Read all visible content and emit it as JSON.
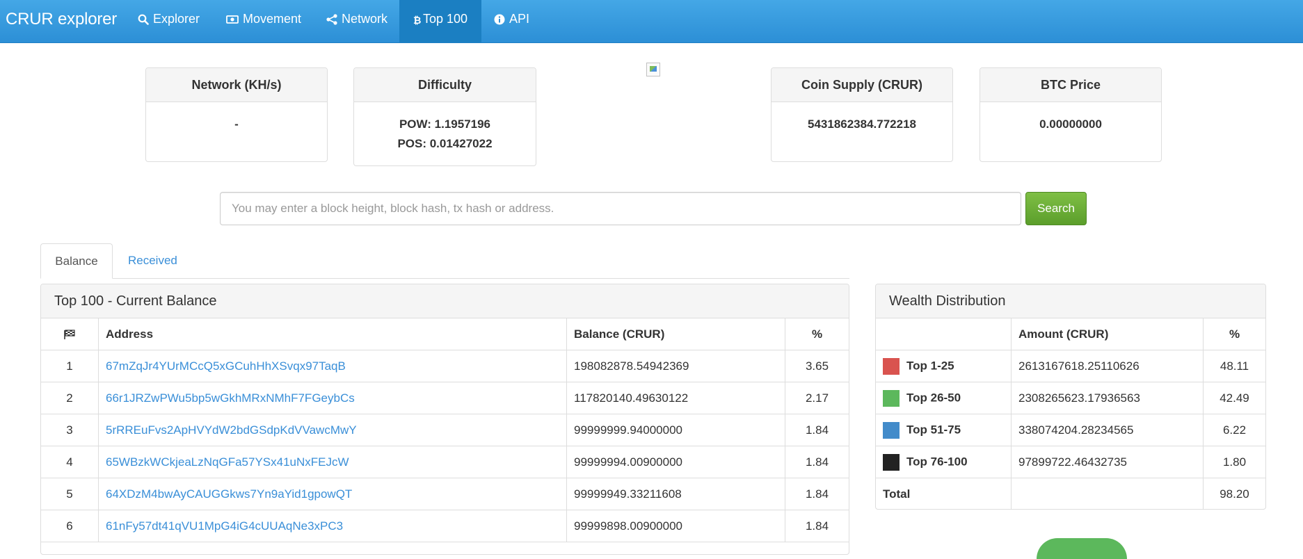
{
  "navbar": {
    "brand": "CRUR explorer",
    "items": [
      {
        "label": "Explorer",
        "icon": "search-icon",
        "active": false
      },
      {
        "label": "Movement",
        "icon": "money-icon",
        "active": false
      },
      {
        "label": "Network",
        "icon": "share-icon",
        "active": false
      },
      {
        "label": "Top 100",
        "icon": "bitcoin-icon",
        "active": true
      },
      {
        "label": "API",
        "icon": "info-circle-icon",
        "active": false
      }
    ],
    "color": "#2c8fd6",
    "active_color": "#1b7fc2"
  },
  "stats": {
    "network": {
      "title": "Network (KH/s)",
      "value": "-"
    },
    "difficulty": {
      "title": "Difficulty",
      "pow": "POW: 1.1957196",
      "pos": "POS: 0.01427022"
    },
    "supply": {
      "title": "Coin Supply (CRUR)",
      "value": "5431862384.772218"
    },
    "btc_price": {
      "title": "BTC Price",
      "value": "0.00000000"
    }
  },
  "search": {
    "placeholder": "You may enter a block height, block hash, tx hash or address.",
    "button_label": "Search",
    "button_color": "#5b9e2b"
  },
  "tabs": [
    {
      "label": "Balance",
      "active": true
    },
    {
      "label": "Received",
      "active": false
    }
  ],
  "top100": {
    "title": "Top 100 - Current Balance",
    "headers": {
      "rank_icon": "flag-checkered-icon",
      "address": "Address",
      "balance": "Balance (CRUR)",
      "percent": "%"
    },
    "rows": [
      {
        "rank": "1",
        "address": "67mZqJr4YUrMCcQ5xGCuhHhXSvqx97TaqB",
        "balance": "198082878.54942369",
        "percent": "3.65"
      },
      {
        "rank": "2",
        "address": "66r1JRZwPWu5bp5wGkhMRxNMhF7FGeybCs",
        "balance": "117820140.49630122",
        "percent": "2.17"
      },
      {
        "rank": "3",
        "address": "5rRREuFvs2ApHVYdW2bdGSdpKdVVawcMwY",
        "balance": "99999999.94000000",
        "percent": "1.84"
      },
      {
        "rank": "4",
        "address": "65WBzkWCkjeaLzNqGFa57YSx41uNxFEJcW",
        "balance": "99999994.00900000",
        "percent": "1.84"
      },
      {
        "rank": "5",
        "address": "64XDzM4bwAyCAUGGkws7Yn9aYid1gpowQT",
        "balance": "99999949.33211608",
        "percent": "1.84"
      },
      {
        "rank": "6",
        "address": "61nFy57dt41qVU1MpG4iG4cUUAqNe3xPC3",
        "balance": "99999898.00900000",
        "percent": "1.84"
      }
    ]
  },
  "wealth": {
    "title": "Wealth Distribution",
    "headers": {
      "label": "",
      "amount": "Amount (CRUR)",
      "percent": "%"
    },
    "rows": [
      {
        "label": "Top 1-25",
        "amount": "2613167618.25110626",
        "percent": "48.11",
        "color": "#d9534f"
      },
      {
        "label": "Top 26-50",
        "amount": "2308265623.17936563",
        "percent": "42.49",
        "color": "#5cb85c"
      },
      {
        "label": "Top 51-75",
        "amount": "338074204.28234565",
        "percent": "6.22",
        "color": "#428bca"
      },
      {
        "label": "Top 76-100",
        "amount": "97899722.46432735",
        "percent": "1.80",
        "color": "#222222"
      }
    ],
    "total": {
      "label": "Total",
      "amount": "",
      "percent": "98.20"
    }
  }
}
